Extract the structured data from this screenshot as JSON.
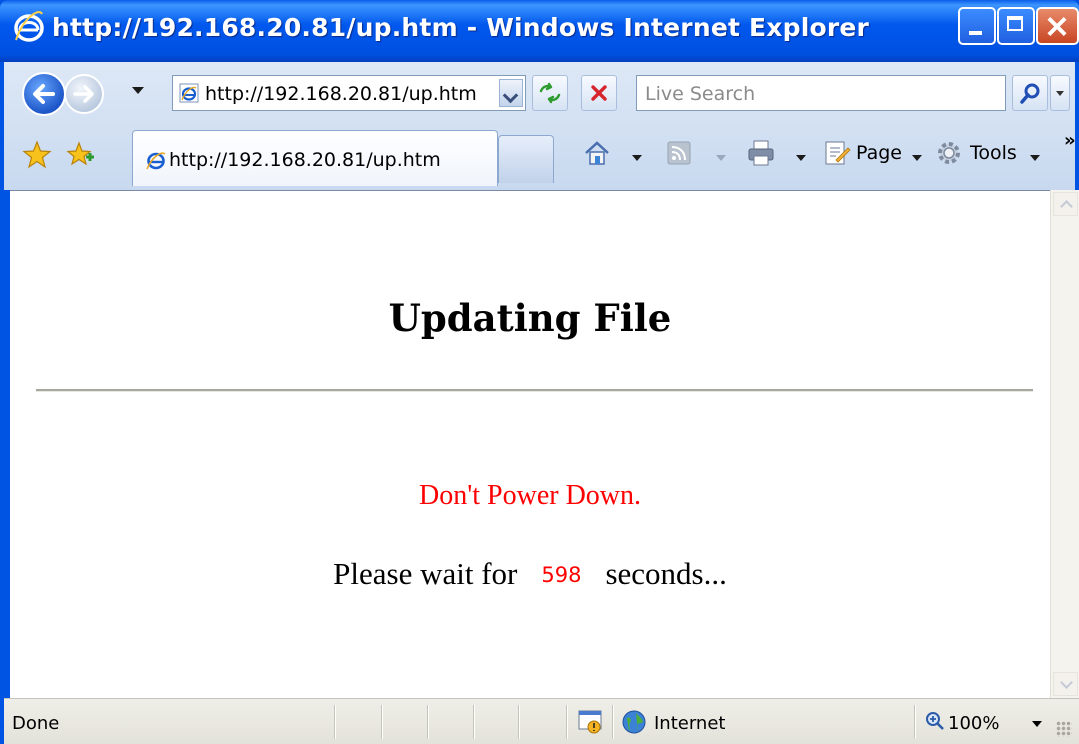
{
  "window": {
    "title": "http://192.168.20.81/up.htm - Windows Internet Explorer"
  },
  "nav": {
    "address": "http://192.168.20.81/up.htm",
    "search_placeholder": "Live Search"
  },
  "tabs": [
    {
      "label": "http://192.168.20.81/up.htm",
      "active": true
    }
  ],
  "command_bar": {
    "page_label": "Page",
    "tools_label": "Tools",
    "chevron": "»"
  },
  "page": {
    "heading": "Updating File",
    "warning": "Don't Power Down.",
    "wait_prefix": "Please wait for",
    "wait_count": "598",
    "wait_suffix": "seconds..."
  },
  "status_bar": {
    "status": "Done",
    "zone": "Internet",
    "zoom": "100%"
  },
  "colors": {
    "title_bar": "#0054e3",
    "warning_text": "#ff0000",
    "countdown_text": "#ff0000"
  }
}
